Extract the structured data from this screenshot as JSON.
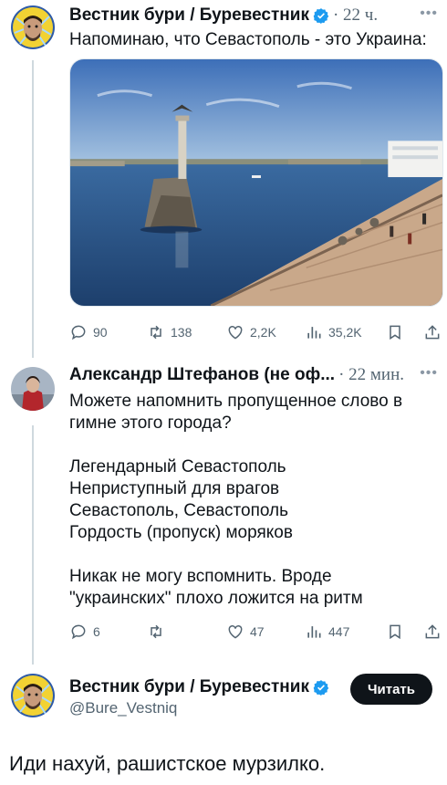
{
  "tweet1": {
    "author": "Вестник бури / Буревестник",
    "time": "· 22 ч.",
    "text": "Напоминаю, что Севастополь - это Украина:",
    "actions": {
      "replies": "90",
      "retweets": "138",
      "likes": "2,2K",
      "views": "35,2K"
    }
  },
  "tweet2": {
    "author": "Александр Штефанов (не оф...",
    "time": "· 22 мин.",
    "text": "Можете напомнить пропущенное слово в\nгимне этого города?\n\nЛегендарный Севастополь\nНеприступный для врагов\nСевастополь, Севастополь\nГордость (пропуск) моряков\n\nНикак не могу вспомнить. Вроде\n\"украинских\" плохо ложится на ритм",
    "actions": {
      "replies": "6",
      "retweets": "",
      "likes": "47",
      "views": "447"
    }
  },
  "tweet3": {
    "author": "Вестник бури / Буревестник",
    "handle": "@Bure_Vestniq",
    "follow_label": "Читать",
    "text": "Иди нахуй, рашистское мурзилко."
  },
  "colors": {
    "verified": "#1d9bf0",
    "muted": "#536471",
    "follow_bg": "#0f1419",
    "thread_line": "#cfd9de"
  },
  "icons": [
    "reply-icon",
    "retweet-icon",
    "like-icon",
    "views-icon",
    "bookmark-icon",
    "share-icon",
    "verified-icon",
    "more-icon"
  ]
}
